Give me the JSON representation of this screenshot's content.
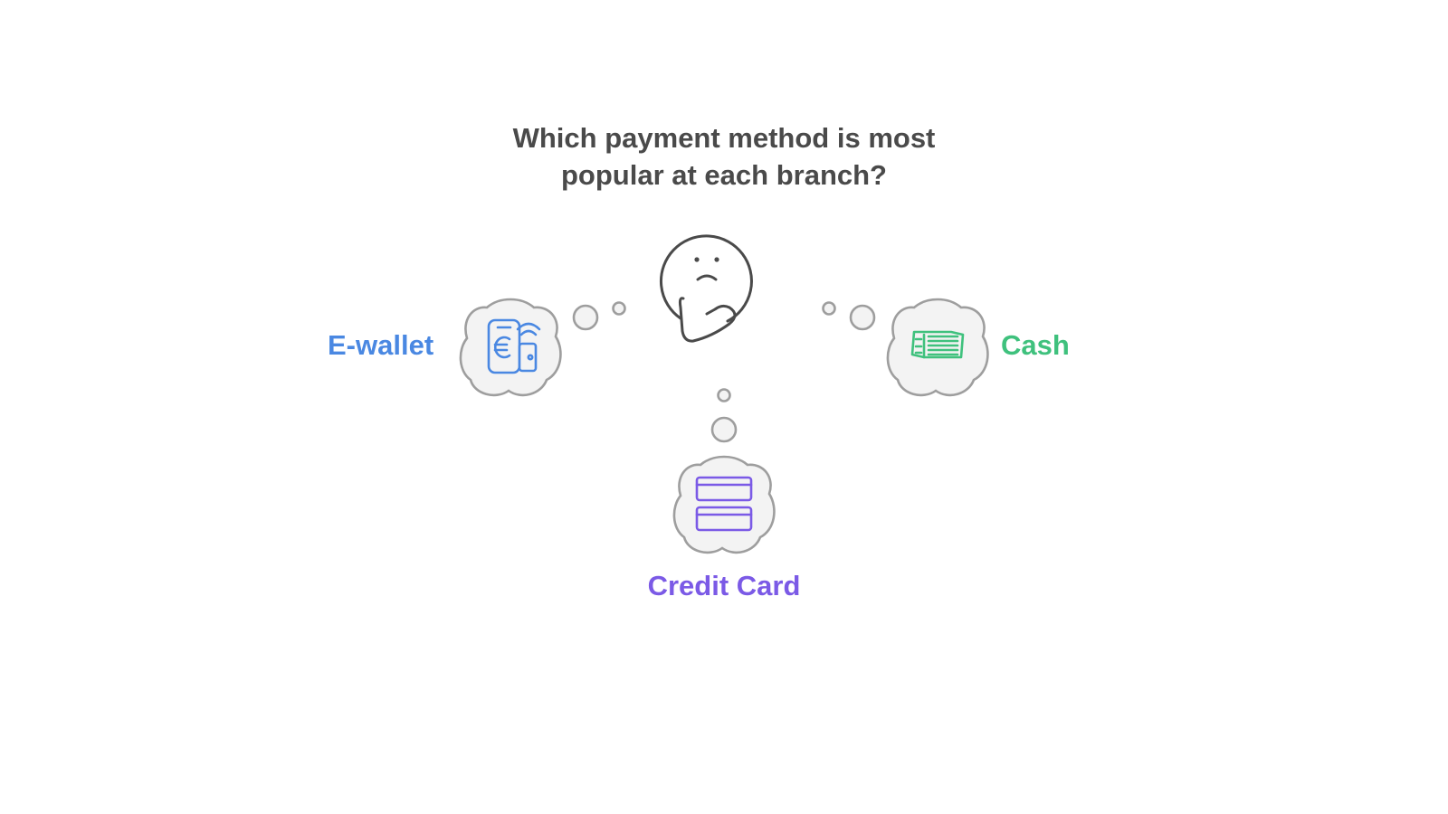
{
  "title": {
    "line1": "Which payment method is most",
    "line2": "popular at each branch?"
  },
  "options": {
    "ewallet": {
      "label": "E-wallet",
      "icon": "euro-wallet-icon",
      "color": "#4a88e2"
    },
    "cash": {
      "label": "Cash",
      "icon": "cash-stack-icon",
      "color": "#3fc17d"
    },
    "credit": {
      "label": "Credit Card",
      "icon": "credit-card-icon",
      "color": "#7b5ae6"
    }
  },
  "center_icon": "thinking-face-icon",
  "colors": {
    "title": "#4a4a4a",
    "cloud_fill": "#f3f3f3",
    "cloud_stroke": "#9e9e9e",
    "face_stroke": "#4a4a4a"
  }
}
